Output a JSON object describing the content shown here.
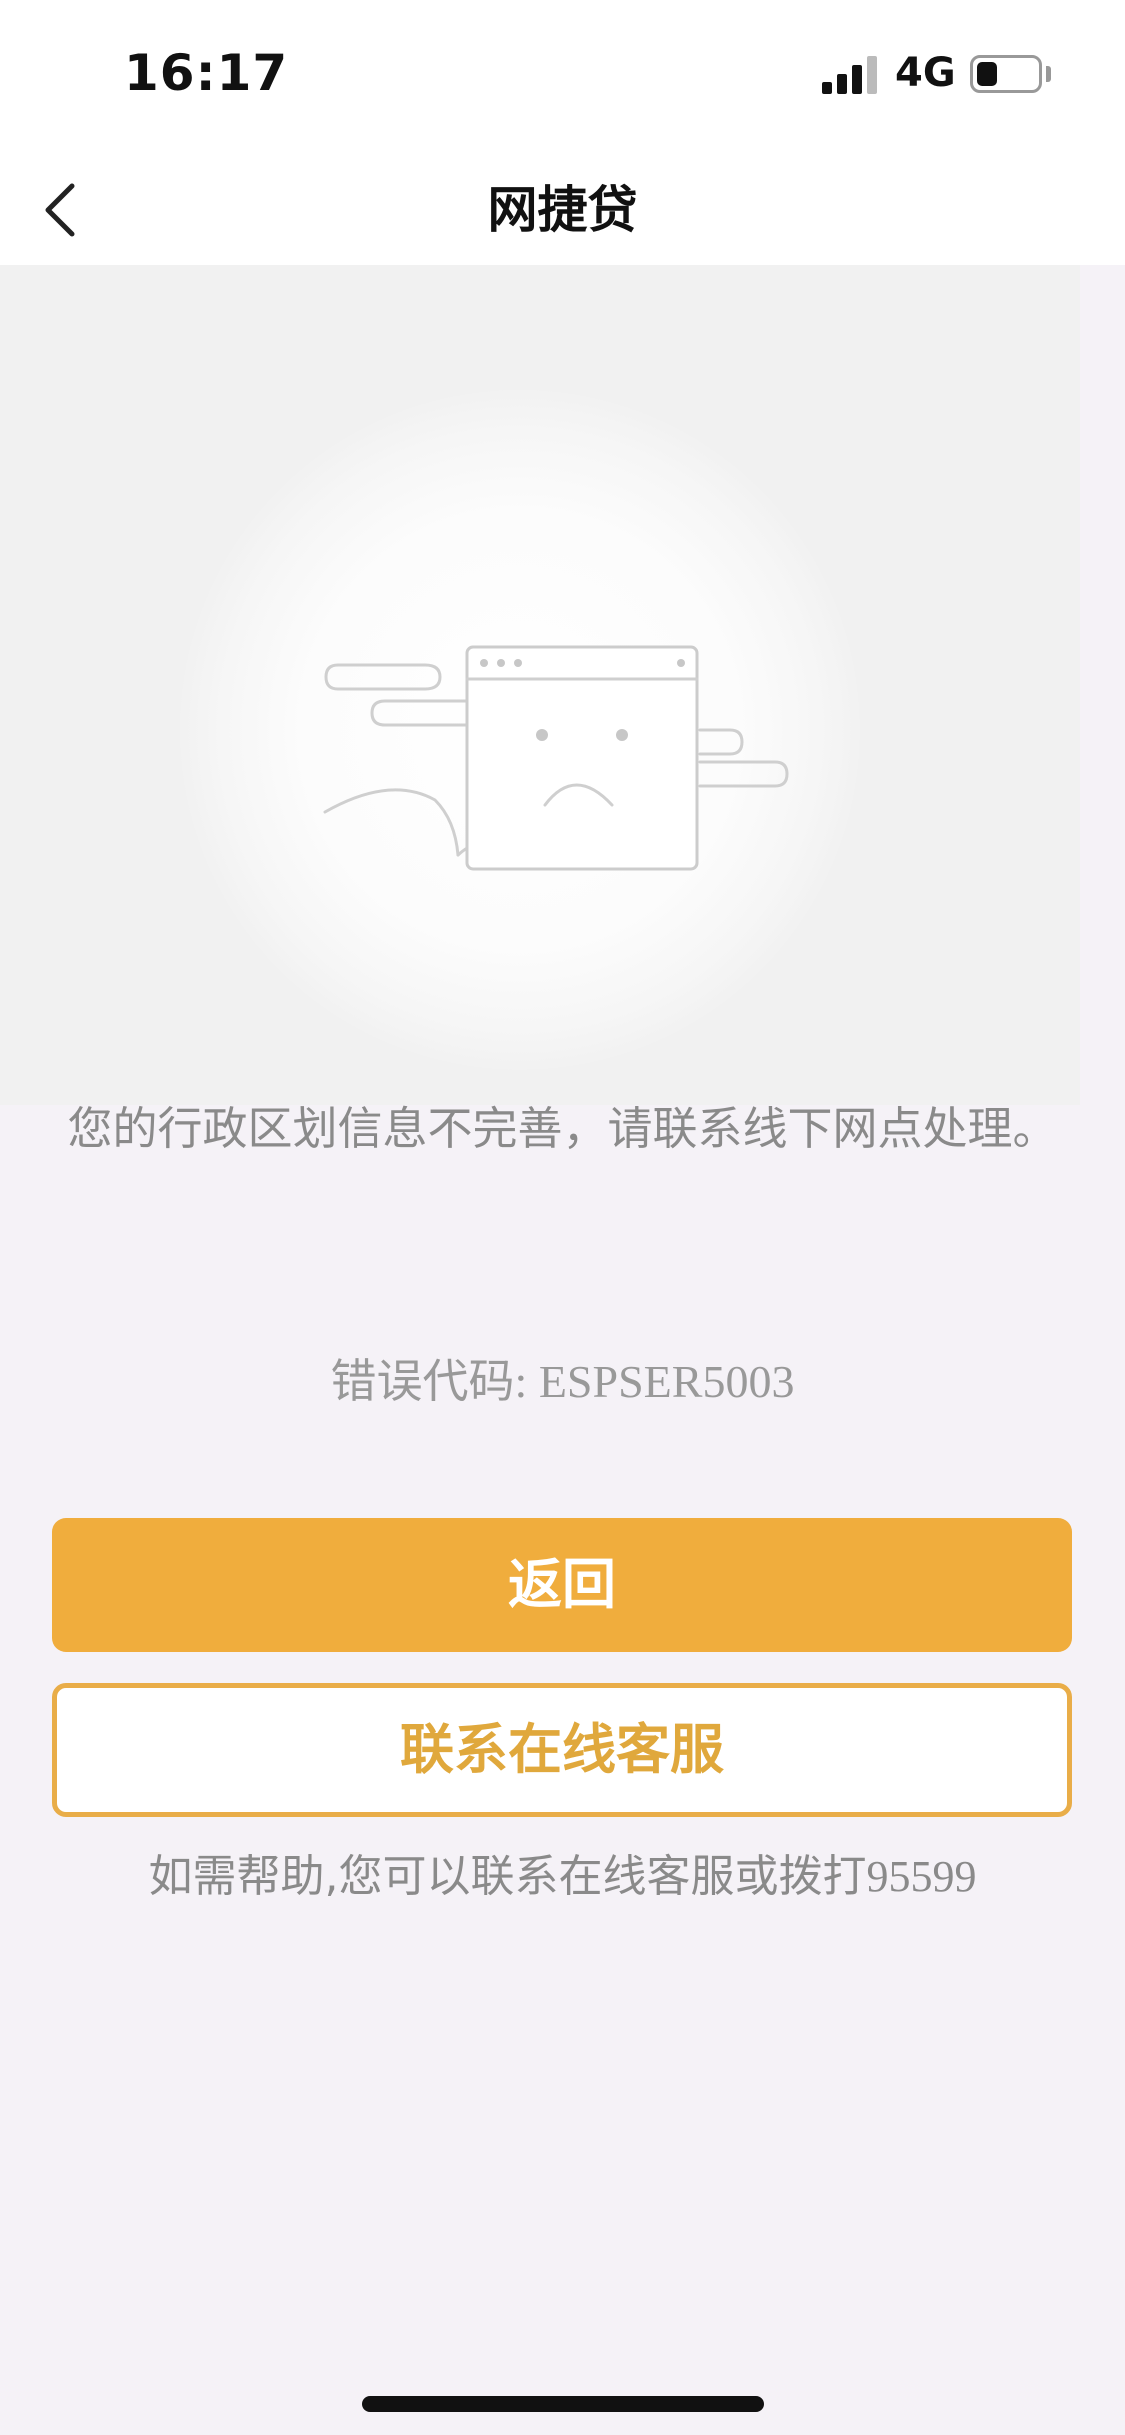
{
  "status_bar": {
    "time": "16:17",
    "network": "4G",
    "battery_level": 0.35
  },
  "nav": {
    "title": "网捷贷",
    "back_icon": "chevron-left-icon"
  },
  "illustration": {
    "icon": "sad-browser-window-icon"
  },
  "error": {
    "message": "您的行政区划信息不完善，请联系线下网点处理。",
    "code_label": "错误代码: ",
    "code_value": "ESPSER5003"
  },
  "buttons": {
    "primary_label": "返回",
    "secondary_label": "联系在线客服"
  },
  "help": {
    "text": "如需帮助,您可以联系在线客服或拨打",
    "phone": "95599"
  },
  "colors": {
    "accent": "#f0ad3d",
    "background": "#f5f2f7"
  }
}
